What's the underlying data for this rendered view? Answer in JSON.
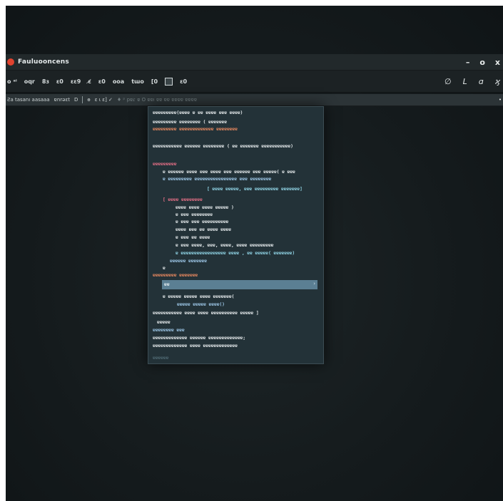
{
  "window": {
    "title": "Fauluooncens",
    "minimize_label": "–",
    "restore_label": "o",
    "close_label": "x"
  },
  "toolbar1": {
    "items": [
      "o ᵃⁱ",
      "oqr",
      "8ɜ",
      "ɛ0",
      "ɛɛ9",
      "ɛ̸",
      "ɛ0",
      "ooa",
      "tɯo",
      "[0",
      "ɛ0"
    ],
    "right_icons": [
      "∅",
      "L",
      "ɑ",
      "ϗ"
    ]
  },
  "toolbar2": {
    "left_text": "Ƨa tasanı aasaaa",
    "item2": "ɐnrəɛt",
    "item3": "D",
    "item4": "ɵ",
    "item5": "ɛ ι ɛ] ✓",
    "faint_text": "♦ ᵖ  pɐɾ   ɐ    O  ɐɐı  ɐɐ   ɐɐ  ɐɐɐɐ  ɐɐɐɐ",
    "end_mark": "•"
  },
  "editor": {
    "lines": [
      "ɐɐɐɐɐɐɐɐɐ(ɐɐɐɐ ɐ ɐɐ ɐɐɐɐ ɐɐɐ ɐɐɐɐ)",
      "ɐɐɐɐɐɐɐɐɐ ɐɐɐɐɐɐɐɐ ( ɐɐɐɐɐɐɐ",
      "ɐɐɐɐɐɐɐɐɐ ɐɐɐɐɐɐɐɐɐɐɐɐɐ ɐɐɐɐɐɐɐɐ",
      "ɐɐɐɐɐɐɐɐɐɐɐ ɐɐɐɐɐɐ ɐɐɐɐɐɐɐɐ ( ɐɐ ɐɐɐɐɐɐɐ ɐɐɐɐɐɐɐɐɐɐɐ)",
      "ɐɐɐɐɐɐɐɐɐ",
      "ɐ ɐɐɐɐɐɐ ɐɐɐɐ ɐɐɐ ɐɐɐɐ ɐɐɐ ɐɐɐɐɐɐ ɐɐɐ ɐɐɐɐɐ( ɐ ɐɐɐ",
      "ɐ ɐɐɐɐɐɐɐɐɐ ɐɐɐɐɐɐɐɐɐɐɐɐɐɐɐɐ ɐɐɐ ɐɐɐɐɐɐɐɐ",
      "[ ɐɐɐɐ ɐɐɐɐɐ, ɐɐɐ ɐɐɐɐɐɐɐɐɐ ɐɐɐɐɐɐɐ]",
      "[ ɐɐɐɐ ɐɐɐɐɐɐɐɐ",
      "ɐɐɐɐ ɐɐɐɐ ɐɐɐɐ ɐɐɐɐɐ )",
      "ɐ ɐɐɐ ɐɐɐɐɐɐɐɐ",
      "ɐ ɐɐɐ ɐɐɐ ɐɐɐɐɐɐɐɐɐɐ",
      "ɐɐɐɐ ɐɐɐ ɐɐ ɐɐɐɐ ɐɐɐɐ",
      "ɐ ɐɐɐ ɐɐ ɐɐɐɐ",
      "ɐ ɐɐɐ ɐɐɐɐ, ɐɐɐ, ɐɐɐɐ, ɐɐɐɐ ɐɐɐɐɐɐɐɐɐ",
      "ɐ ɐɐɐɐɐɐɐɐɐɐɐɐɐɐɐɐɐ ɐɐɐɐ , ɐɐ ɐɐɐɐɐ( ɐɐɐɐɐɐɐ)",
      "ɐɐɐɐɐɐ ɐɐɐɐɐɐɐ",
      "ɐ",
      "ɐɐɐɐɐɐɐɐɐ ɐɐɐɐɐɐɐ",
      "ɐ ɐɐɐɐɐ ɐɐɐɐɐ ɐɐɐɐ ɐɐɐɐɐɐɐ(",
      "ɐɐɐɐɐ ɐɐɐɐɐ ɐɐɐɐ()",
      "ɐɐɐɐɐɐɐɐɐɐɐ ɐɐɐɐ ɐɐɐɐ ɐɐɐɐɐɐɐɐɐɐ ɐɐɐɐɐ ]",
      "ɐɐɐɐɐ",
      "ɐɐɐɐɐɐɐɐ ɐɐɐ",
      "ɐɐɐɐɐɐɐɐɐɐɐɐɐ ɐɐɐɐɐɐ ɐɐɐɐɐɐɐɐɐɐɐɐɐ;",
      "ɐɐɐɐɐɐɐɐɐɐɐɐɐ ɐɐɐɐ ɐɐɐɐɐɐɐɐɐɐɐɐɐ",
      "ɐɐɐɐɐɐ"
    ],
    "selected_text": "ɐɐ",
    "selected_marker": "›"
  },
  "colors": {
    "accent": "#e0432f",
    "selection": "#5b7f93",
    "editor_bg": "#233238"
  }
}
